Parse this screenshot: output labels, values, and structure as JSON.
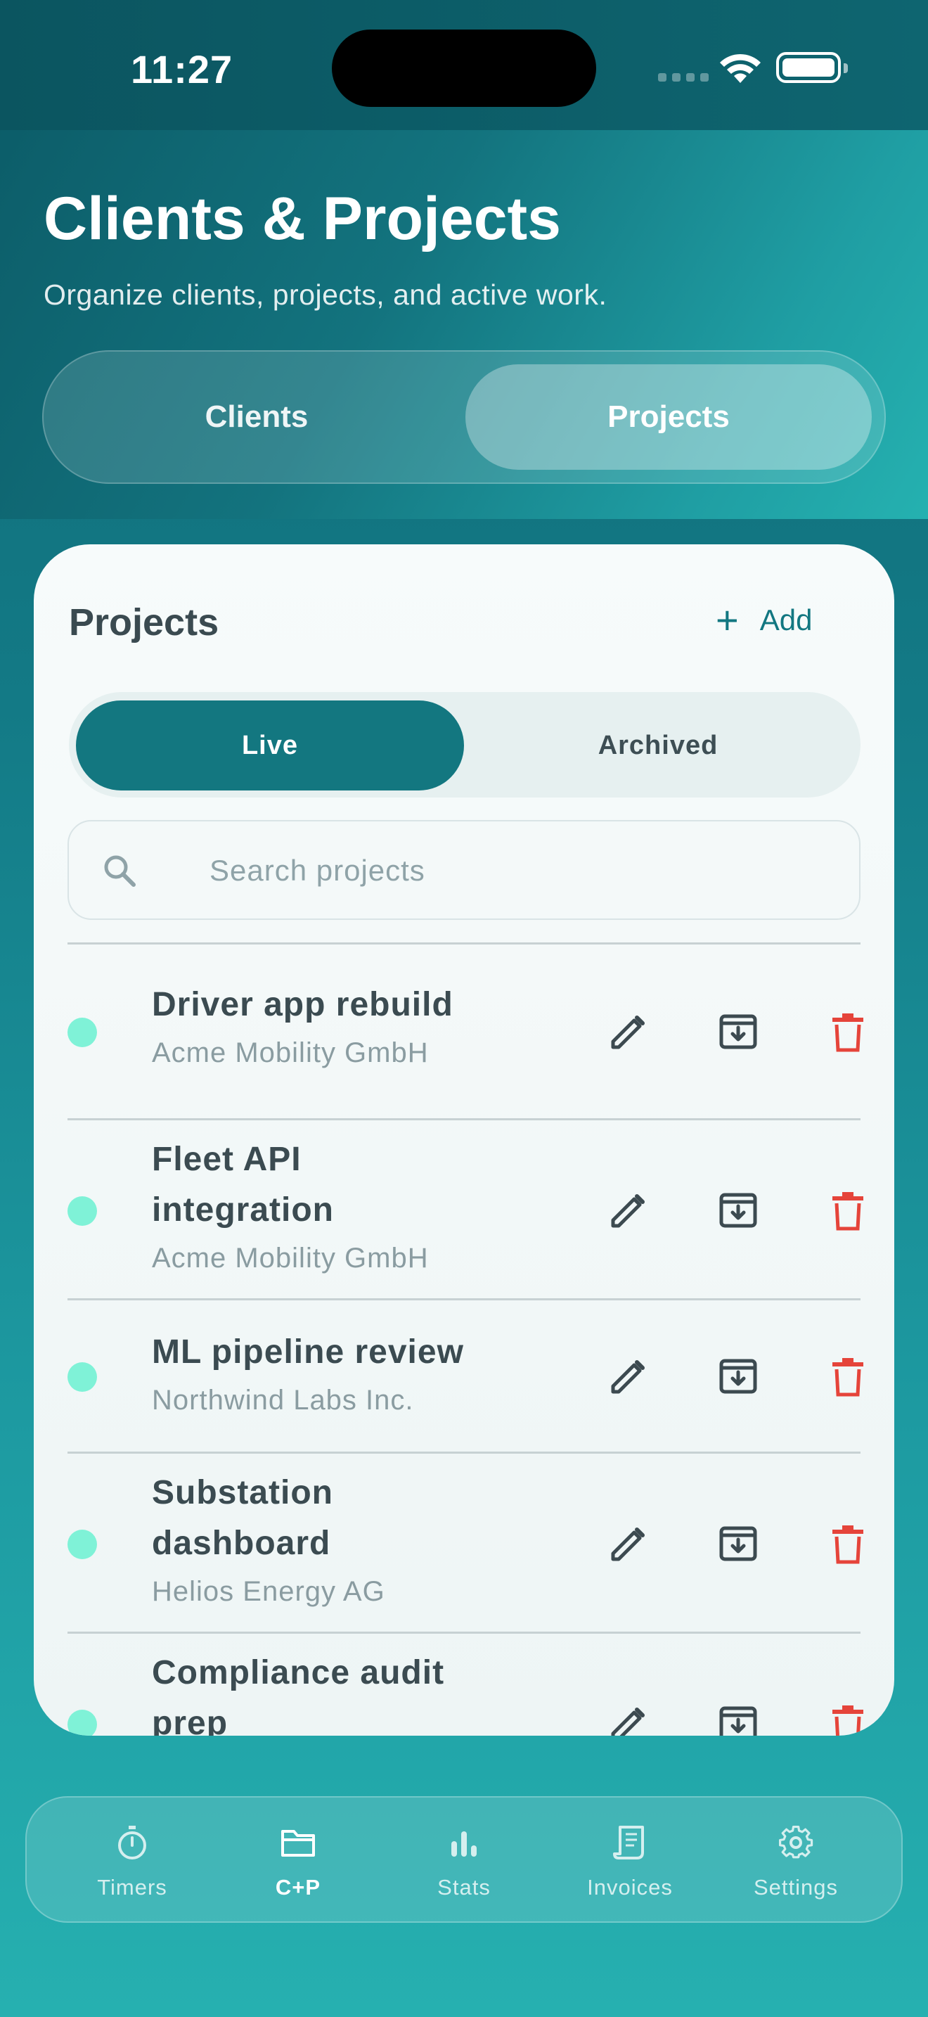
{
  "status_bar": {
    "time": "11:27"
  },
  "header": {
    "title": "Clients & Projects",
    "subtitle": "Organize clients, projects, and active work."
  },
  "top_segment": {
    "options": [
      "Clients",
      "Projects"
    ],
    "selected": "Projects"
  },
  "card": {
    "title": "Projects",
    "add_label": "Add",
    "filter": {
      "options": [
        "Live",
        "Archived"
      ],
      "selected": "Live"
    },
    "search": {
      "placeholder": "Search projects",
      "value": ""
    },
    "projects": [
      {
        "name": "Driver app rebuild",
        "client": "Acme Mobility GmbH"
      },
      {
        "name": "Fleet API integration",
        "client": "Acme Mobility GmbH"
      },
      {
        "name": "ML pipeline review",
        "client": "Northwind Labs Inc."
      },
      {
        "name": "Substation dashboard",
        "client": "Helios Energy AG"
      },
      {
        "name": "Compliance audit prep",
        "client": ""
      }
    ]
  },
  "tabbar": {
    "items": [
      {
        "label": "Timers",
        "icon": "stopwatch-icon"
      },
      {
        "label": "C+P",
        "icon": "folder-icon"
      },
      {
        "label": "Stats",
        "icon": "bar-chart-icon"
      },
      {
        "label": "Invoices",
        "icon": "invoice-icon"
      },
      {
        "label": "Settings",
        "icon": "gear-icon"
      }
    ],
    "active": "C+P"
  },
  "colors": {
    "accent": "#137780",
    "status_dot": "#7ff2d7",
    "delete": "#e5443a"
  }
}
